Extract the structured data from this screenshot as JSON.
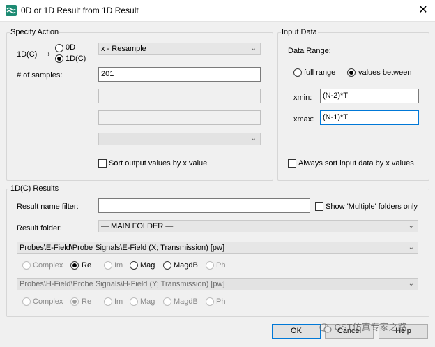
{
  "window": {
    "title": "0D or 1D Result from 1D Result",
    "close_glyph": "✕"
  },
  "specify_action": {
    "group_label": "Specify Action",
    "op_label": "1D(C) ⟶",
    "radio_0d": "0D",
    "radio_1dc": "1D(C)",
    "action_select": "x - Resample",
    "samples_label": "# of samples:",
    "samples_value": "201",
    "sort_output": "Sort output values by x value"
  },
  "input_data": {
    "group_label": "Input Data",
    "data_range_label": "Data Range:",
    "full_range": "full range",
    "values_between": "values between",
    "xmin_label": "xmin:",
    "xmin_value": "(N-2)*T",
    "xmax_label": "xmax:",
    "xmax_value": "(N-1)*T",
    "always_sort": "Always sort input data by x values"
  },
  "results": {
    "group_label": "1D(C) Results",
    "filter_label": "Result name filter:",
    "filter_value": "",
    "show_multiple": "Show 'Multiple' folders only",
    "folder_label": "Result folder:",
    "folder_value": "— MAIN FOLDER —",
    "probe1": "Probes\\E-Field\\Probe Signals\\E-Field (X; Transmission) [pw]",
    "probe2": "Probes\\H-Field\\Probe Signals\\H-Field (Y; Transmission) [pw]",
    "complex_opts": {
      "complex": "Complex",
      "re": "Re",
      "im": "Im",
      "mag": "Mag",
      "magdb": "MagdB",
      "ph": "Ph"
    }
  },
  "buttons": {
    "ok": "OK",
    "cancel": "Cancel",
    "help": "Help"
  },
  "watermark": "CST仿真专家之路",
  "colors": {
    "accent": "#0078d7",
    "icon": "#1d8b73"
  }
}
